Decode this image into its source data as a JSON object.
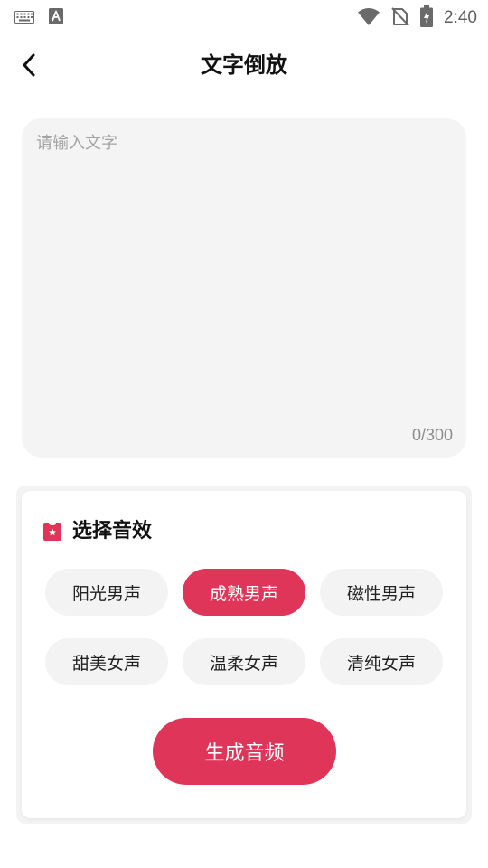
{
  "status_bar": {
    "time": "2:40",
    "icons": [
      "keyboard-icon",
      "font-icon",
      "wifi-icon",
      "no-sim-icon",
      "battery-charging-icon"
    ]
  },
  "header": {
    "title": "文字倒放",
    "back_icon": "chevron-left-icon"
  },
  "text_input": {
    "placeholder": "请输入文字",
    "value": "",
    "counter": "0/300"
  },
  "effects": {
    "title": "选择音效",
    "icon": "ticket-star-icon",
    "options": [
      {
        "label": "阳光男声",
        "selected": false
      },
      {
        "label": "成熟男声",
        "selected": true
      },
      {
        "label": "磁性男声",
        "selected": false
      },
      {
        "label": "甜美女声",
        "selected": false
      },
      {
        "label": "温柔女声",
        "selected": false
      },
      {
        "label": "清纯女声",
        "selected": false
      }
    ]
  },
  "actions": {
    "generate_label": "生成音频"
  },
  "colors": {
    "accent": "#de3558",
    "chip_bg": "#f3f3f3",
    "input_bg": "#f4f4f4"
  }
}
